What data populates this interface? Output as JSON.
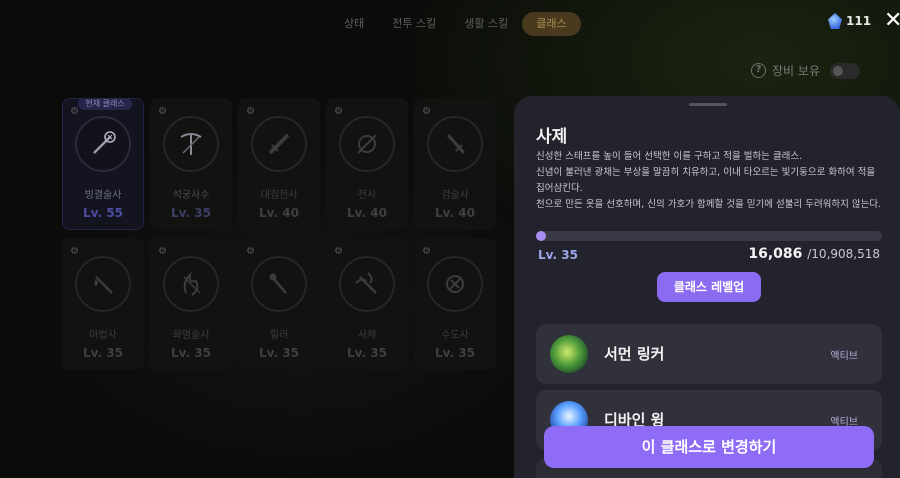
{
  "nav": {
    "tabs": [
      {
        "label": "상태"
      },
      {
        "label": "전투 스킬"
      },
      {
        "label": "생활 스킬"
      },
      {
        "label": "클래스",
        "active": true
      }
    ]
  },
  "currency": {
    "amount": "111",
    "icon": "gem-icon"
  },
  "equip": {
    "label": "장비 보유",
    "help": "?"
  },
  "current_badge": "현재 클래스",
  "classes": [
    {
      "name": "빙결술사",
      "level": "Lv. 55",
      "current": true
    },
    {
      "name": "석궁사수",
      "level": "Lv. 35",
      "selected": true
    },
    {
      "name": "대검전사",
      "level": "Lv. 40"
    },
    {
      "name": "전사",
      "level": "Lv. 40"
    },
    {
      "name": "검술사",
      "level": "Lv. 40"
    },
    {
      "name": "마법사",
      "level": "Lv. 35"
    },
    {
      "name": "화염술사",
      "level": "Lv. 35"
    },
    {
      "name": "힐러",
      "level": "Lv. 35"
    },
    {
      "name": "사제",
      "level": "Lv. 35"
    },
    {
      "name": "수도사",
      "level": "Lv. 35"
    }
  ],
  "panel": {
    "title": "사제",
    "desc": [
      "신성한 스태프를 높이 들어 선택한 이를 구하고 적을 벌하는 클래스.",
      "신념이 불러낸 광채는 부상을 말끔히 치유하고, 이내 타오르는 빛기둥으로 화하여 적을",
      "집어삼킨다.",
      "천으로 만든 옷을 선호하며, 신의 가호가 함께할 것을 믿기에 섣불리 두려워하지 않는다."
    ],
    "level": "Lv. 35",
    "exp_current": "16,086",
    "exp_total": "/10,908,518",
    "exp_fraction": 0.0015,
    "levelup_label": "클래스 레벨업",
    "skills": [
      {
        "name": "서먼 링커",
        "type": "액티브"
      },
      {
        "name": "디바인 윙",
        "type": "액티브"
      }
    ],
    "change_label": "이 클래스로 변경하기"
  }
}
